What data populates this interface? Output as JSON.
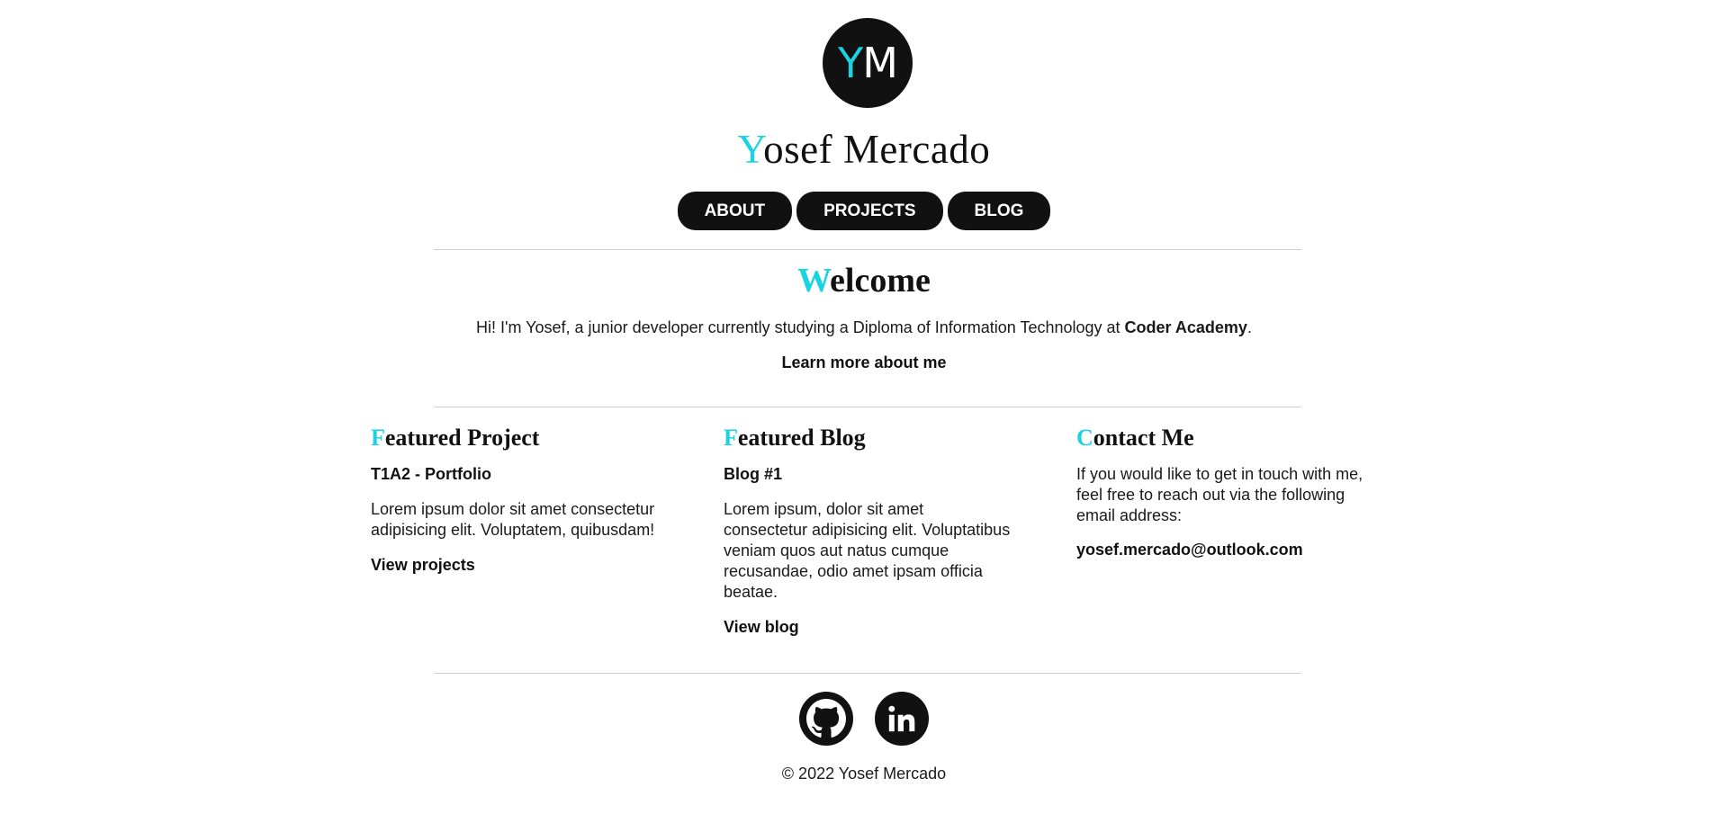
{
  "header": {
    "logo_letter_1": "Y",
    "logo_letter_2": "M",
    "title_first": "Y",
    "title_rest": "osef Mercado"
  },
  "nav": {
    "items": [
      {
        "label": "ABOUT"
      },
      {
        "label": "PROJECTS"
      },
      {
        "label": "BLOG"
      }
    ]
  },
  "welcome": {
    "title_first": "W",
    "title_rest": "elcome",
    "text_before": "Hi! I'm Yosef, a junior developer currently studying a Diploma of Information Technology at ",
    "text_bold": "Coder Academy",
    "text_after": ".",
    "link": "Learn more about me"
  },
  "featured_project": {
    "title_first": "F",
    "title_rest": "eatured Project",
    "subtitle": "T1A2 - Portfolio",
    "text": "Lorem ipsum dolor sit amet consectetur adipisicing elit. Voluptatem, quibusdam!",
    "link": "View projects"
  },
  "featured_blog": {
    "title_first": "F",
    "title_rest": "eatured Blog",
    "subtitle": "Blog #1",
    "text": "Lorem ipsum, dolor sit amet consectetur adipisicing elit. Voluptatibus veniam quos aut natus cumque recusandae, odio amet ipsam officia beatae.",
    "link": "View blog"
  },
  "contact": {
    "title_first": "C",
    "title_rest": "ontact Me",
    "text": "If you would like to get in touch with me, feel free to reach out via the following email address:",
    "email": "yosef.mercado@outlook.com"
  },
  "footer": {
    "social": [
      "github-icon",
      "linkedin-icon"
    ],
    "copyright": "© 2022 Yosef Mercado"
  },
  "colors": {
    "accent": "#19d3e0",
    "dark": "#111111"
  }
}
